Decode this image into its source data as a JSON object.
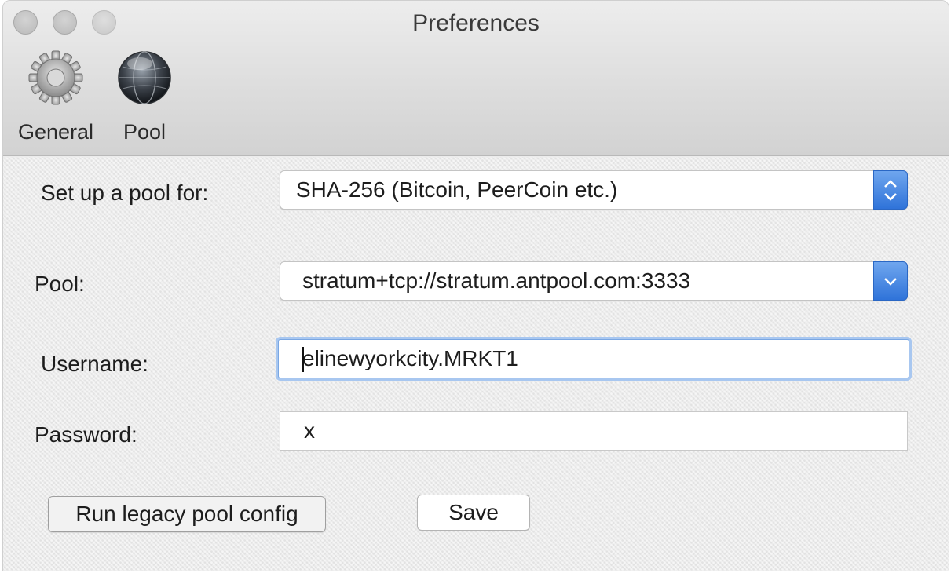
{
  "window": {
    "title": "Preferences"
  },
  "toolbar": {
    "items": [
      {
        "label": "General",
        "icon": "gear-icon"
      },
      {
        "label": "Pool",
        "icon": "globe-icon"
      }
    ]
  },
  "form": {
    "setup_label": "Set up a pool for:",
    "setup_value": "SHA-256 (Bitcoin, PeerCoin etc.)",
    "pool_label": "Pool:",
    "pool_value": "stratum+tcp://stratum.antpool.com:3333",
    "username_label": "Username:",
    "username_value": "elinewyorkcity.MRKT1",
    "password_label": "Password:",
    "password_value": "x"
  },
  "buttons": {
    "legacy_label": "Run legacy pool config",
    "save_label": "Save"
  },
  "colors": {
    "accent": "#2f73d9",
    "focus_ring": "#a8c7f0"
  }
}
